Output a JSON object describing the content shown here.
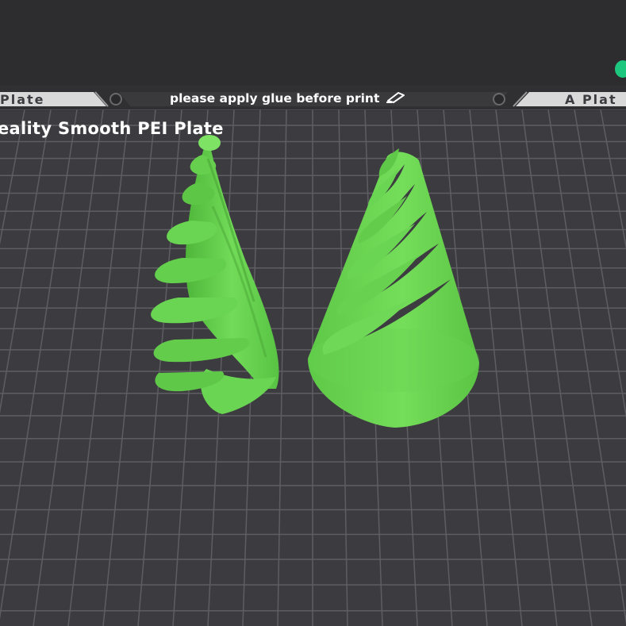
{
  "plate_tabs": {
    "left_label": "Plate",
    "right_label": "A Plat"
  },
  "plate_note": {
    "text": "please apply glue before print",
    "icon": "pencil-icon"
  },
  "plate_name": "eality Smooth PEI Plate",
  "colors": {
    "model": "#6ad552",
    "bed": "#3c3c40",
    "grid": "#5e5e62",
    "status": "#1ec77e"
  }
}
